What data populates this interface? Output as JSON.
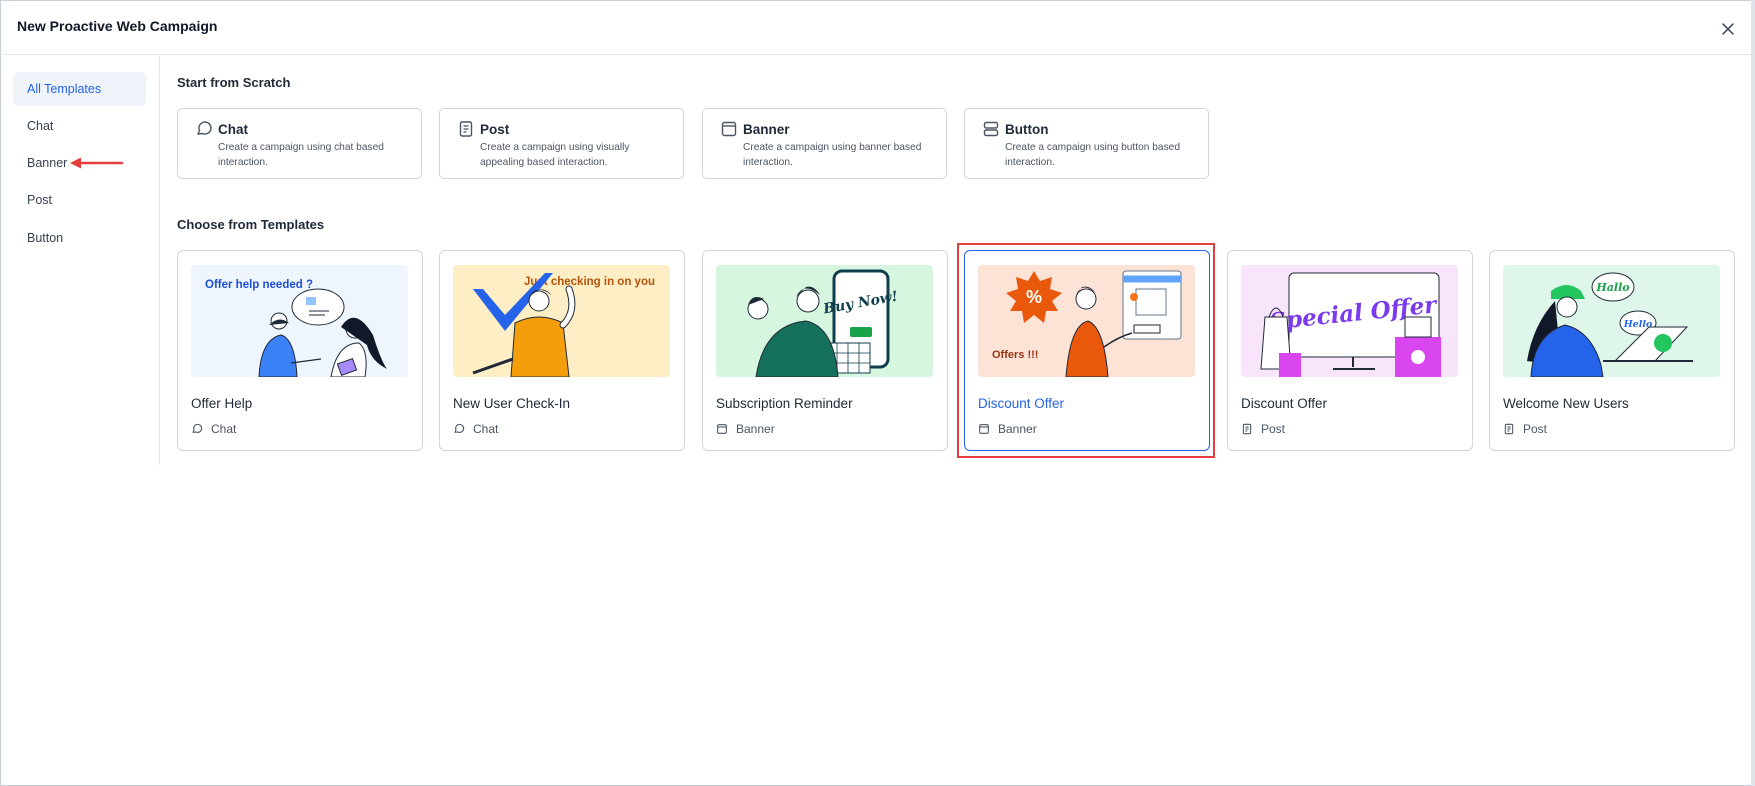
{
  "dialog": {
    "title": "New Proactive Web Campaign"
  },
  "sidebar": {
    "items": [
      {
        "label": "All Templates",
        "active": true
      },
      {
        "label": "Chat"
      },
      {
        "label": "Banner"
      },
      {
        "label": "Post"
      },
      {
        "label": "Button"
      }
    ]
  },
  "scratch": {
    "heading": "Start from Scratch",
    "cards": [
      {
        "icon": "chat-bubble-icon",
        "name": "Chat",
        "description": "Create a campaign using chat based interaction."
      },
      {
        "icon": "post-doc-icon",
        "name": "Post",
        "description": "Create a campaign using visually appealing based interaction."
      },
      {
        "icon": "banner-window-icon",
        "name": "Banner",
        "description": "Create a campaign using banner based interaction."
      },
      {
        "icon": "button-stack-icon",
        "name": "Button",
        "description": "Create a campaign using button based interaction."
      }
    ]
  },
  "templates": {
    "heading": "Choose from Templates",
    "cards": [
      {
        "name": "Offer Help",
        "type": "Chat",
        "illustration_text": "Offer help needed ?",
        "bg": "#eef5fc"
      },
      {
        "name": "New User Check-In",
        "type": "Chat",
        "illustration_text": "Just checking in on you",
        "bg": "#fdeec6"
      },
      {
        "name": "Subscription Reminder",
        "type": "Banner",
        "illustration_text": "Buy Now!",
        "bg": "#d7f6df"
      },
      {
        "name": "Discount Offer",
        "type": "Banner",
        "illustration_text": "Offers !!!",
        "bg": "#fde3d6",
        "selected": true
      },
      {
        "name": "Discount Offer",
        "type": "Post",
        "illustration_text": "Special Offer",
        "bg": "#f8e4fb"
      },
      {
        "name": "Welcome New Users",
        "type": "Post",
        "illustration_text": "Hallo",
        "illustration_text_2": "Hello",
        "bg": "#dff6ea"
      }
    ]
  },
  "colors": {
    "accent": "#2563eb",
    "highlight": "#e53e3e",
    "border": "#d1d5db"
  }
}
